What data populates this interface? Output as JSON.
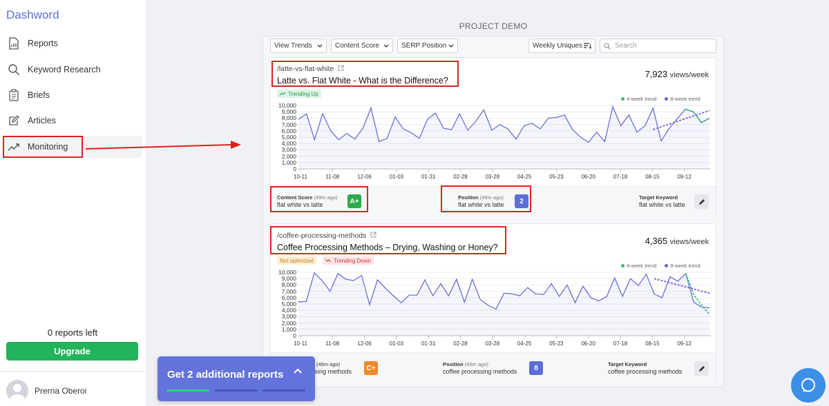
{
  "brand": "Dashword",
  "nav": [
    {
      "label": "Reports",
      "icon": "report-icon"
    },
    {
      "label": "Keyword Research",
      "icon": "search-icon"
    },
    {
      "label": "Briefs",
      "icon": "clipboard-icon"
    },
    {
      "label": "Articles",
      "icon": "edit-icon"
    },
    {
      "label": "Monitoring",
      "icon": "trending-icon"
    }
  ],
  "reports_left": "0 reports left",
  "upgrade_label": "Upgrade",
  "user_name": "Prerna Oberoi",
  "project_title": "PROJECT DEMO",
  "toolbar": {
    "view_trends": "View Trends",
    "content_score": "Content Score",
    "serp_position": "SERP Position",
    "weekly_uniques": "Weekly Uniques",
    "search_placeholder": "Search"
  },
  "legend": {
    "four_week": "4-week trend",
    "eight_week": "8-week trend"
  },
  "colors": {
    "line": "#6b6fd6",
    "four_week": "#2cc275",
    "eight_week": "#7b5bd6",
    "accent": "#5b6fd6",
    "highlight": "#e0201f"
  },
  "cards": [
    {
      "url": "/latte-vs-flat-white",
      "title": "Latte vs. Flat White - What is the Difference?",
      "views_value": "7,923",
      "views_unit": "views/week",
      "badges": [
        {
          "text": "Trending Up",
          "kind": "up"
        }
      ],
      "content_score_label": "Content Score",
      "content_score_time": "(49m ago)",
      "content_score_keyword": "flat white vs latte",
      "content_score_grade": "A+",
      "content_score_color": "#2eaa4e",
      "position_label": "Position",
      "position_time": "(49m ago)",
      "position_keyword": "flat white vs latte",
      "position_value": "2",
      "target_label": "Target Keyword",
      "target_keyword": "flat white vs latte"
    },
    {
      "url": "/coffee-processing-methods",
      "title": "Coffee Processing Methods – Drying, Washing or Honey?",
      "views_value": "4,365",
      "views_unit": "views/week",
      "badges": [
        {
          "text": "Not optimized",
          "kind": "notopt"
        },
        {
          "text": "Trending Down",
          "kind": "down"
        }
      ],
      "content_score_time": "(49m ago)",
      "content_score_keyword": "essing methods",
      "content_score_grade": "C+",
      "content_score_color": "#f0892b",
      "position_label": "Position",
      "position_time": "(49m ago)",
      "position_keyword": "coffee processing methods",
      "position_value": "8",
      "target_label": "Target Keyword",
      "target_keyword": "coffee processing methods"
    }
  ],
  "chart_data": [
    {
      "type": "line",
      "y_ticks": [
        "10,000",
        "9,000",
        "8,000",
        "7,000",
        "6,000",
        "5,000",
        "4,000",
        "3,000",
        "2,000",
        "1,000",
        "0"
      ],
      "ylim": [
        0,
        10000
      ],
      "x_ticks": [
        "10-11",
        "11-08",
        "12-06",
        "01-03",
        "01-31",
        "02-28",
        "03-28",
        "04-25",
        "05-23",
        "06-20",
        "07-18",
        "08-15",
        "09-12"
      ],
      "series": [
        {
          "values": [
            7800,
            8700,
            4600,
            8700,
            6000,
            4600,
            5600,
            4700,
            6400,
            9600,
            4300,
            4800,
            8200,
            6300,
            5700,
            4800,
            7800,
            8800,
            6400,
            6200,
            8700,
            6100,
            7500,
            9300,
            6100,
            7000,
            6300,
            4700,
            6800,
            7200,
            6300,
            8000,
            8100,
            8500,
            6200,
            5000,
            4200,
            5800,
            4300,
            9800,
            6800,
            8500,
            5800,
            6800,
            9600,
            4400,
            6400,
            7900,
            9400,
            9000,
            7300,
            8000
          ]
        },
        {
          "trend": "4-week",
          "values": [
            9400,
            9000,
            7300,
            8000
          ]
        },
        {
          "trend": "8-week",
          "values": [
            6200,
            9200
          ]
        }
      ]
    },
    {
      "type": "line",
      "y_ticks": [
        "10,000",
        "9,000",
        "8,000",
        "7,000",
        "6,000",
        "5,000",
        "4,000",
        "3,000",
        "2,000",
        "1,000",
        "0"
      ],
      "ylim": [
        0,
        10000
      ],
      "x_ticks": [
        "10-11",
        "11-08",
        "12-06",
        "01-03",
        "01-31",
        "02-28",
        "03-28",
        "04-25",
        "05-23",
        "06-20",
        "07-18",
        "08-15",
        "09-12"
      ],
      "series": [
        {
          "values": [
            5300,
            5400,
            9900,
            8700,
            7000,
            9800,
            8900,
            8700,
            9500,
            4900,
            8800,
            7500,
            6300,
            5200,
            6400,
            6400,
            8800,
            6300,
            8200,
            6300,
            8900,
            5300,
            8900,
            5700,
            4800,
            4200,
            6700,
            6600,
            6300,
            7600,
            6600,
            6500,
            8200,
            6200,
            8000,
            5200,
            7800,
            6000,
            5500,
            6200,
            9100,
            6200,
            9000,
            7900,
            9700,
            6600,
            6000,
            9300,
            8600,
            9800,
            5300,
            4500,
            4400
          ]
        },
        {
          "trend": "4-week",
          "values": [
            9800,
            6500,
            4800,
            3400
          ]
        },
        {
          "trend": "8-week",
          "values": [
            9000,
            6700
          ]
        }
      ]
    }
  ],
  "promo": {
    "text": "Get 2 additional reports"
  }
}
